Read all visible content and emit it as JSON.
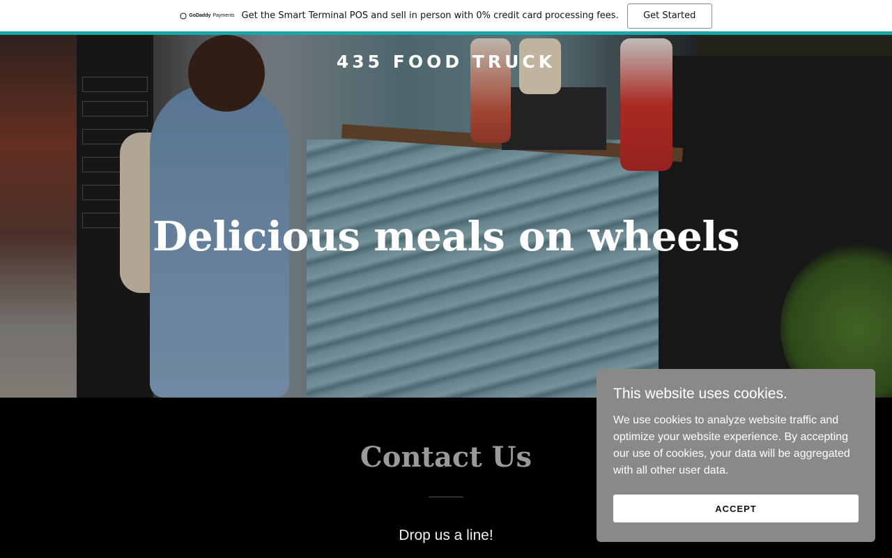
{
  "promo": {
    "logo_brand": "GoDaddy",
    "logo_product": "Payments",
    "message": "Get the Smart Terminal POS and sell in person with 0% credit card processing fees.",
    "cta_label": "Get Started"
  },
  "colors": {
    "accent_line": "#1aa7a8",
    "cookie_bg": "#898989",
    "contact_title": "#9a9a9a"
  },
  "hero": {
    "site_title": "435 FOOD TRUCK",
    "heading": "Delicious meals on wheels"
  },
  "contact": {
    "title": "Contact Us",
    "subtitle": "Drop us a line!"
  },
  "cookie_banner": {
    "title": "This website uses cookies.",
    "body": "We use cookies to analyze website traffic and optimize your website experience. By accepting our use of cookies, your data will be aggregated with all other user data.",
    "accept_label": "ACCEPT"
  }
}
